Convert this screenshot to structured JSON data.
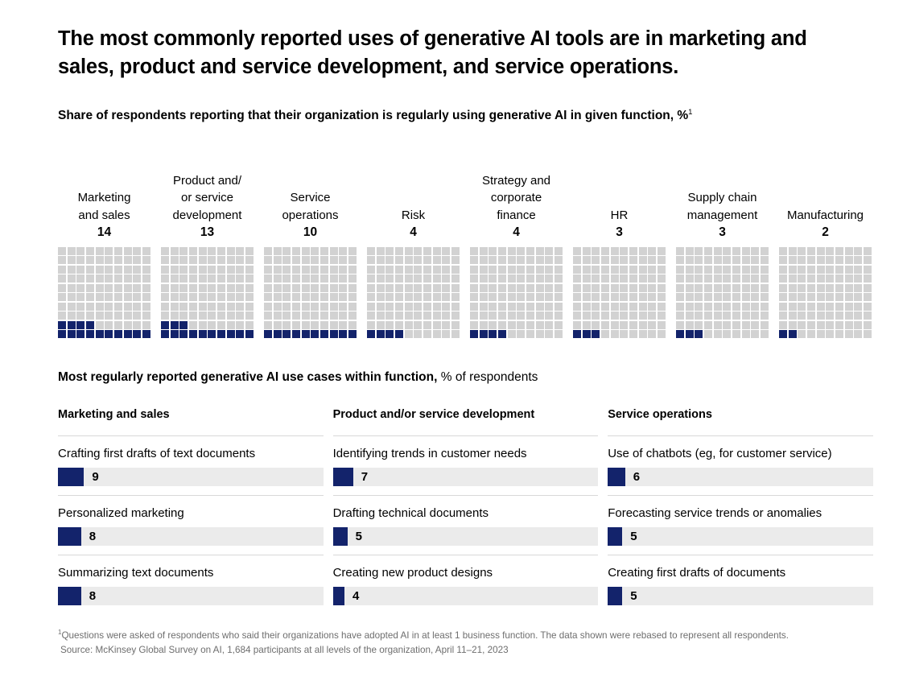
{
  "title": "The most commonly reported uses of generative AI tools are in marketing and sales, product and service development, and service operations.",
  "subtitle": {
    "text": "Share of respondents reporting that their organization is regularly using generative AI in given function, %",
    "footnote_marker": "1"
  },
  "usecase_heading": {
    "bold": "Most regularly reported generative AI use cases within function,",
    "light": " % of respondents"
  },
  "footnotes": {
    "note_marker": "1",
    "note": "Questions were asked of respondents who said their organizations have adopted AI in at least 1 business function. The data shown were rebased to represent all respondents.",
    "source": "Source: McKinsey Global Survey on AI, 1,684 participants at all levels of the organization, April 11–21, 2023"
  },
  "colors": {
    "accent": "#13236b",
    "waffle_empty": "#d2d2d2",
    "bar_track": "#ebebeb",
    "divider": "#d8d8d8"
  },
  "chart_data": [
    {
      "type": "bar",
      "subtype": "waffle",
      "title": "Share of respondents reporting that their organization is regularly using generative AI in given function, %",
      "xlabel": "",
      "ylabel": "Share of respondents, %",
      "ylim": [
        0,
        100
      ],
      "grid": false,
      "legend": "none",
      "waffle_rows": 10,
      "waffle_cols": 10,
      "categories": [
        "Marketing and sales",
        "Product and/or service development",
        "Service operations",
        "Risk",
        "Strategy and corporate finance",
        "HR",
        "Supply chain management",
        "Manufacturing"
      ],
      "values": [
        14,
        13,
        10,
        4,
        4,
        3,
        3,
        2
      ],
      "label_lines": [
        [
          "Marketing",
          "and sales"
        ],
        [
          "Product and/",
          "or service",
          "development"
        ],
        [
          "Service",
          "operations"
        ],
        [
          "Risk"
        ],
        [
          "Strategy and",
          "corporate",
          "finance"
        ],
        [
          "HR"
        ],
        [
          "Supply chain",
          "management"
        ],
        [
          "Manufacturing"
        ]
      ]
    },
    {
      "type": "bar",
      "title": "Most regularly reported generative AI use cases within function, % of respondents",
      "xlabel": "",
      "ylabel": "% of respondents",
      "xlim": [
        0,
        100
      ],
      "grid": false,
      "legend": "none",
      "groups": [
        {
          "name": "Marketing and sales",
          "categories": [
            "Crafting first drafts of text documents",
            "Personalized marketing",
            "Summarizing text documents"
          ],
          "values": [
            9,
            8,
            8
          ]
        },
        {
          "name": "Product and/or service development",
          "categories": [
            "Identifying trends in customer needs",
            "Drafting technical documents",
            "Creating new product designs"
          ],
          "values": [
            7,
            5,
            4
          ]
        },
        {
          "name": "Service operations",
          "categories": [
            "Use of chatbots (eg, for customer service)",
            "Forecasting service trends or anomalies",
            "Creating first drafts of documents"
          ],
          "values": [
            6,
            5,
            5
          ]
        }
      ]
    }
  ]
}
